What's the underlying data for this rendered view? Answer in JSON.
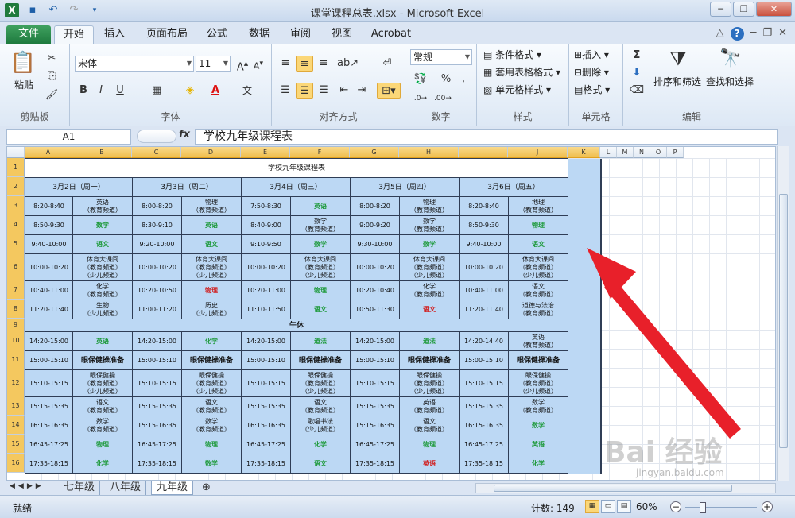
{
  "window": {
    "title": "课堂课程总表.xlsx - Microsoft Excel"
  },
  "tabs": [
    "文件",
    "开始",
    "插入",
    "页面布局",
    "公式",
    "数据",
    "审阅",
    "视图",
    "Acrobat"
  ],
  "ribbon": {
    "paste_label": "粘贴",
    "clipboard_label": "剪贴板",
    "font_name": "宋体",
    "font_size": "11",
    "font_label": "字体",
    "align_label": "对齐方式",
    "number_format": "常规",
    "number_label": "数字",
    "cond_format": "条件格式",
    "table_format": "套用表格格式",
    "cell_style": "单元格样式",
    "style_label": "样式",
    "insert": "插入",
    "delete": "删除",
    "format": "格式",
    "cells_label": "单元格",
    "sort_filter": "排序和筛选",
    "find_select": "查找和选择",
    "edit_label": "编辑",
    "bold": "B",
    "italic": "I",
    "underline": "U",
    "sigma": "Σ",
    "percent": "%",
    "comma": ","
  },
  "formula_bar": {
    "name_box": "A1",
    "fx": "fx",
    "content": "学校九年级课程表"
  },
  "columns": [
    "A",
    "B",
    "C",
    "D",
    "E",
    "F",
    "G",
    "H",
    "I",
    "J",
    "K",
    "L",
    "M",
    "N",
    "O",
    "P"
  ],
  "rows": [
    "1",
    "2",
    "3",
    "4",
    "5",
    "6",
    "7",
    "8",
    "9",
    "10",
    "11",
    "12",
    "13",
    "14",
    "15",
    "16"
  ],
  "sheet": {
    "title": "学校九年级课程表",
    "dates": [
      "3月2日（周一）",
      "3月3日（周二）",
      "3月4日（周三）",
      "3月5日（周四）",
      "3月6日（周五）"
    ],
    "r3": [
      "8:20-8:40",
      "英语\n（教育频道）",
      "8:00-8:20",
      "物理\n（教育频道）",
      "7:50-8:30",
      "英语",
      "8:00-8:20",
      "物理\n（教育频道）",
      "8:20-8:40",
      "地理\n（教育频道）"
    ],
    "r4": [
      "8:50-9:30",
      "数学",
      "8:30-9:10",
      "英语",
      "8:40-9:00",
      "数学\n（教育频道）",
      "9:00-9:20",
      "数学\n（教育频道）",
      "8:50-9:30",
      "物理"
    ],
    "r5": [
      "9:40-10:00",
      "语文",
      "9:20-10:00",
      "语文",
      "9:10-9:50",
      "数学",
      "9:30-10:00",
      "数学",
      "9:40-10:00",
      "语文"
    ],
    "r6": [
      "10:00-10:20",
      "体育大课间\n（教育频道）\n（少儿频道）",
      "10:00-10:20",
      "体育大课间\n（教育频道）\n（少儿频道）",
      "10:00-10:20",
      "体育大课间\n（教育频道）\n（少儿频道）",
      "10:00-10:20",
      "体育大课间\n（教育频道）\n（少儿频道）",
      "10:00-10:20",
      "体育大课间\n（教育频道）\n（少儿频道）"
    ],
    "r7": [
      "10:40-11:00",
      "化学\n（教育频道）",
      "10:20-10:50",
      "物理",
      "10:20-11:00",
      "物理",
      "10:20-10:40",
      "化学\n（教育频道）",
      "10:40-11:00",
      "语文\n（教育频道）"
    ],
    "r8": [
      "11:20-11:40",
      "生物\n（少儿频道）",
      "11:00-11:20",
      "历史\n（少儿频道）",
      "11:10-11:50",
      "语文",
      "10:50-11:30",
      "语文",
      "11:20-11:40",
      "道德与法治\n（教育频道）"
    ],
    "r9": "午休",
    "r10": [
      "14:20-15:00",
      "英语",
      "14:20-15:00",
      "化学",
      "14:20-15:00",
      "道法",
      "14:20-15:00",
      "道法",
      "14:20-14:40",
      "英语\n（教育频道）"
    ],
    "r11": [
      "15:00-15:10",
      "眼保健操准备",
      "15:00-15:10",
      "眼保健操准备",
      "15:00-15:10",
      "眼保健操准备",
      "15:00-15:10",
      "眼保健操准备",
      "15:00-15:10",
      "眼保健操准备"
    ],
    "r12": [
      "15:10-15:15",
      "眼保健操\n（教育频道）\n（少儿频道）",
      "15:10-15:15",
      "眼保健操\n（教育频道）\n（少儿频道）",
      "15:10-15:15",
      "眼保健操\n（教育频道）\n（少儿频道）",
      "15:10-15:15",
      "眼保健操\n（教育频道）\n（少儿频道）",
      "15:10-15:15",
      "眼保健操\n（教育频道）\n（少儿频道）"
    ],
    "r13": [
      "15:15-15:35",
      "语文\n（教育频道）",
      "15:15-15:35",
      "语文\n（教育频道）",
      "15:15-15:35",
      "语文\n（教育频道）",
      "15:15-15:35",
      "英语\n（教育频道）",
      "15:15-15:35",
      "数学\n（教育频道）"
    ],
    "r14": [
      "16:15-16:35",
      "数学\n（教育频道）",
      "15:15-16:35",
      "数学\n（教育频道）",
      "16:15-16:35",
      "歌唱书法\n（少儿频道）",
      "15:15-16:35",
      "语文\n（教育频道）",
      "16:15-16:35",
      "数学"
    ],
    "r15": [
      "16:45-17:25",
      "物理",
      "16:45-17:25",
      "物理",
      "16:45-17:25",
      "化学",
      "16:45-17:25",
      "物理",
      "16:45-17:25",
      "英语"
    ],
    "r16": [
      "17:35-18:15",
      "化学",
      "17:35-18:15",
      "数学",
      "17:35-18:15",
      "语文",
      "17:35-18:15",
      "英语",
      "17:35-18:15",
      "化学"
    ]
  },
  "sheet_tabs": [
    "七年级",
    "八年级",
    "九年级"
  ],
  "status": {
    "ready": "就绪",
    "count": "计数: 149",
    "zoom": "60%"
  },
  "watermark": {
    "text": "Bai 经验",
    "url": "jingyan.baidu.com"
  },
  "colors": {
    "cell_blue": "#bcd8f4",
    "green_text": "#1e9a3b",
    "red_text": "#d12020",
    "arrow_red": "#e8202a"
  }
}
